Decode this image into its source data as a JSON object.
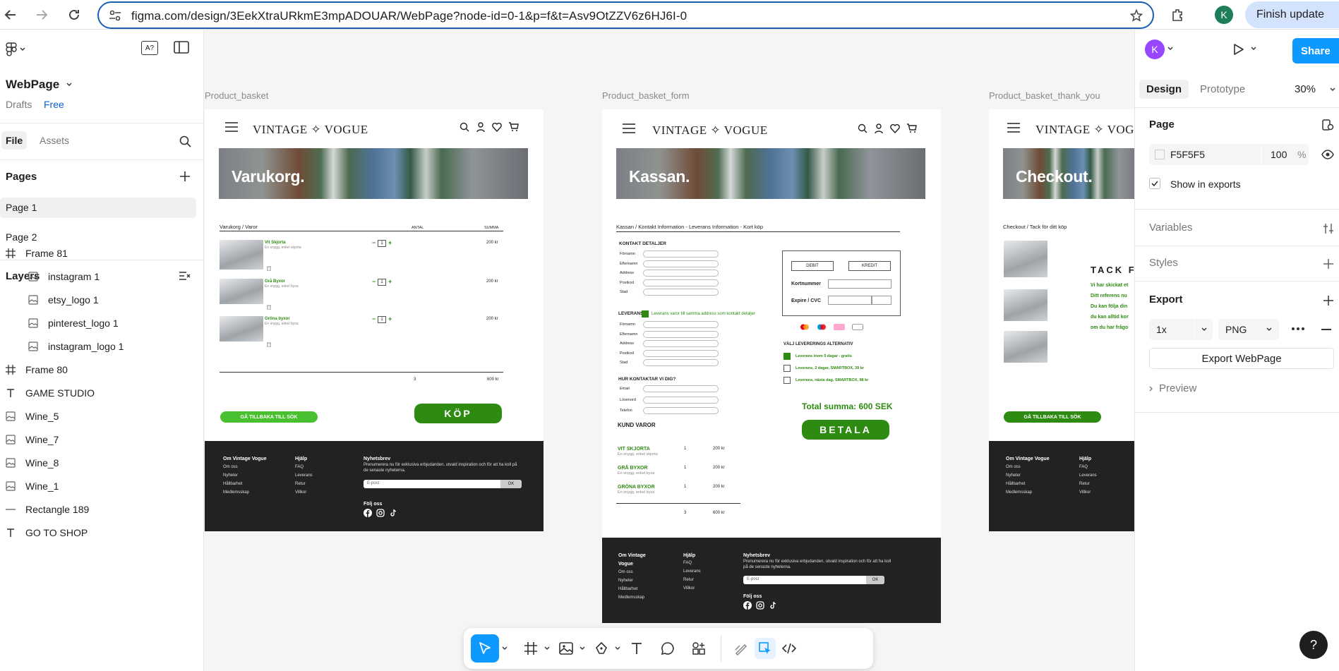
{
  "browser": {
    "url": "figma.com/design/3EekXtraURkmE3mpADOUAR/WebPage?node-id=0-1&p=f&t=Asv9OtZZV6z6HJ6I-0",
    "finish_update": "Finish update",
    "profile_initial": "K"
  },
  "left_panel": {
    "file_name": "WebPage",
    "drafts": "Drafts",
    "plan": "Free",
    "tab_file": "File",
    "tab_assets": "Assets",
    "pages_title": "Pages",
    "pages": [
      "Page 1",
      "Page 2"
    ],
    "layers_title": "Layers",
    "layers": [
      {
        "name": "Frame 81",
        "type": "frame",
        "child": false
      },
      {
        "name": "instagram 1",
        "type": "image",
        "child": true
      },
      {
        "name": "etsy_logo 1",
        "type": "image",
        "child": true
      },
      {
        "name": "pinterest_logo 1",
        "type": "image",
        "child": true
      },
      {
        "name": "instagram_logo 1",
        "type": "image",
        "child": true
      },
      {
        "name": "Frame 80",
        "type": "frame",
        "child": false
      },
      {
        "name": "GAME STUDIO",
        "type": "text",
        "child": false
      },
      {
        "name": "Wine_5",
        "type": "image",
        "child": false
      },
      {
        "name": "Wine_7",
        "type": "image",
        "child": false
      },
      {
        "name": "Wine_8",
        "type": "image",
        "child": false
      },
      {
        "name": "Wine_1",
        "type": "image",
        "child": false
      },
      {
        "name": "Rectangle 189",
        "type": "rect",
        "child": false
      },
      {
        "name": "GO TO SHOP",
        "type": "text",
        "child": false
      }
    ]
  },
  "right_panel": {
    "user_initial": "K",
    "share": "Share",
    "tab_design": "Design",
    "tab_prototype": "Prototype",
    "zoom": "30%",
    "page_title": "Page",
    "page_color": "F5F5F5",
    "page_opacity": "100",
    "percent": "%",
    "show_in_exports": "Show in exports",
    "variables": "Variables",
    "styles": "Styles",
    "export": "Export",
    "export_scale": "1x",
    "export_format": "PNG",
    "export_button": "Export WebPage",
    "preview": "Preview"
  },
  "canvas": {
    "frame_labels": [
      "Product_basket",
      "Product_basket_form",
      "Product_basket_thank_you"
    ],
    "logo": "VINTAGE ✧ VOGUE",
    "basket": {
      "hero": "Varukorg.",
      "breadcrumb": "Varukorg / Varor",
      "col_antal": "ANTAL",
      "col_summa": "SUMMA",
      "items": [
        {
          "name": "Vit Skjorta",
          "desc": "En snygg, enkel skjorta",
          "qty": "1",
          "price": "200 kr"
        },
        {
          "name": "Grå Byxor",
          "desc": "En snygg, enkel byxa",
          "qty": "1",
          "price": "200 kr"
        },
        {
          "name": "Gröna byxor",
          "desc": "En snygg, enkel byxa",
          "qty": "1",
          "price": "200 kr"
        }
      ],
      "total_qty": "3",
      "total_sum": "600 kr",
      "back_btn": "GÅ TILLBAKA TILL SÖK",
      "buy_btn": "KÖP"
    },
    "footer": {
      "col1_title": "Om Vintage Vogue",
      "col1": [
        "Om oss",
        "Nyheter",
        "Hållbarhet",
        "Medlemsskap"
      ],
      "col2_title": "Hjälp",
      "col2": [
        "FAQ",
        "Leverans",
        "Retur",
        "Villkor"
      ],
      "news_title": "Nyhetsbrev",
      "news_text": "Prenumerera nu för exklusiva erbjudanden, utvald inspiration och för att ha koll på de senaste nyheterna.",
      "email_placeholder": "E-post",
      "ok": "OK",
      "follow": "Följ oss"
    },
    "form": {
      "hero": "Kassan.",
      "breadcrumb": "Kassan / Kontakt Information - Leverans Information - Kort köp",
      "contact_title": "KONTAKT DETALJER",
      "contact_fields": [
        "Förnamn",
        "Efternamn",
        "Address",
        "Postkod",
        "Stad"
      ],
      "delivery_title": "LEVERANS",
      "delivery_check": "Leverans varor till samma address som kontakt detaljer",
      "delivery_fields": [
        "Förnamn",
        "Efternamn",
        "Address",
        "Postkod",
        "Stad"
      ],
      "contact_how": "HUR KONTAKTAR VI DIG?",
      "how_fields": [
        "Email",
        "Lösenord",
        "Telefon"
      ],
      "debit": "DEBIT",
      "kredit": "KREDIT",
      "kortnummer": "Kortnummer",
      "expire": "Expire / CVC",
      "delivery_alt_title": "VÄLJ LEVERERINGS ALTERNATIV",
      "delivery_alts": [
        "Leverans inom 5 dagar - gratis",
        "Leverans, 2 dagar, SMARTBOX, 39 kr",
        "Leverans, nästa dag, SMARTBOX, 98 kr"
      ],
      "total": "Total summa: 600 SEK",
      "pay_btn": "BETALA",
      "items_title": "KUND VAROR",
      "items": [
        {
          "name": "VIT SKJORTA",
          "desc": "En snygg, enkel skjorta",
          "qty": "1",
          "price": "200 kr"
        },
        {
          "name": "GRÅ BYXOR",
          "desc": "En snygg, enkel byxa",
          "qty": "1",
          "price": "200 kr"
        },
        {
          "name": "GRÖNA BYXOR",
          "desc": "En snygg, enkel byxa",
          "qty": "1",
          "price": "200 kr"
        }
      ],
      "total_qty": "3",
      "total_sum": "600 kr",
      "footer_col1_title_a": "Om Vintage",
      "footer_col1_title_b": "Vogue"
    },
    "thanks": {
      "hero": "Checkout.",
      "breadcrumb": "Checkout / Tack för ditt köp",
      "heading": "TACK F",
      "lines": [
        "Vi har skickat et",
        "Ditt referens nu",
        "Du kan följa din",
        "du kan alltid kor",
        "om du har frågo"
      ],
      "back_btn": "GÅ TILLBAKA TILL SÖK"
    }
  }
}
